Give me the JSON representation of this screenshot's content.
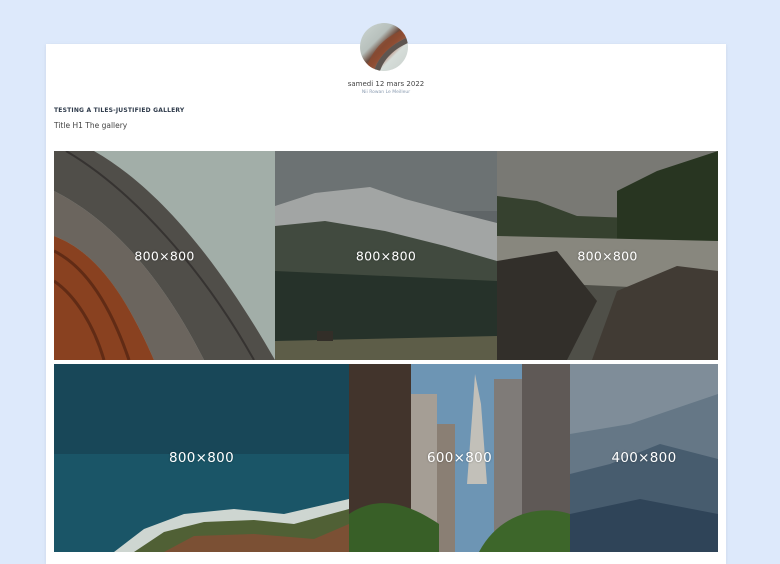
{
  "post": {
    "date": "samedi 12 mars 2022",
    "author": "Nii Rowan Le Meilleur",
    "category": "TESTING A TILES-JUSTIFIED GALLERY",
    "title": "Title H1 The gallery"
  },
  "gallery": {
    "tiles": [
      {
        "label": "800×800",
        "subject": "curved wooden architecture"
      },
      {
        "label": "800×800",
        "subject": "snowy forested mountain"
      },
      {
        "label": "800×800",
        "subject": "river with rocks"
      },
      {
        "label": "800×800",
        "subject": "aerial ocean coast"
      },
      {
        "label": "600×800",
        "subject": "city skyscrapers"
      },
      {
        "label": "400×800",
        "subject": "misty blue mountains"
      }
    ]
  },
  "colors": {
    "background": "#dde9fb",
    "card": "#ffffff",
    "category_text": "#2e3a4a"
  }
}
